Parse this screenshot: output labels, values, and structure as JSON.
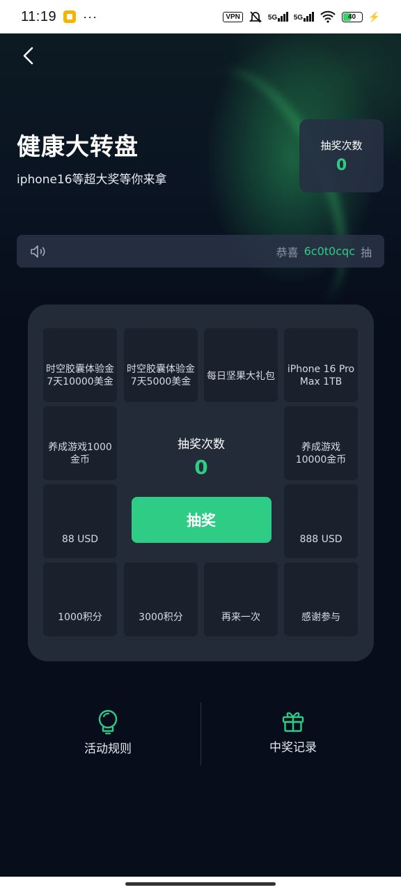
{
  "status_bar": {
    "time": "11:19",
    "dots": "···",
    "vpn": "VPN",
    "sig1": "5G",
    "sig2": "5G",
    "battery": "40"
  },
  "header": {
    "title": "健康大转盘",
    "subtitle": "iphone16等超大奖等你来拿"
  },
  "count_card": {
    "label": "抽奖次数",
    "value": "0"
  },
  "notice": {
    "prefix": "恭喜",
    "user": "6c0t0cqc",
    "suffix": "抽"
  },
  "prizes": [
    "时空胶囊体验金7天10000美金",
    "时空胶囊体验金7天5000美金",
    "每日坚果大礼包",
    "iPhone 16 Pro Max 1TB",
    "养成游戏1000金币",
    "养成游戏10000金币",
    "88 USD",
    "888 USD",
    "1000积分",
    "3000积分",
    "再来一次",
    "感谢参与"
  ],
  "center": {
    "label": "抽奖次数",
    "value": "0",
    "button": "抽奖"
  },
  "bottom": {
    "rules": "活动规则",
    "records": "中奖记录"
  },
  "colors": {
    "accent": "#2ecc85",
    "background": "#070d1b",
    "card": "#232a38",
    "cell": "#1a202c"
  },
  "icons": [
    "back-icon",
    "speaker-icon",
    "bulb-icon",
    "gift-icon"
  ]
}
